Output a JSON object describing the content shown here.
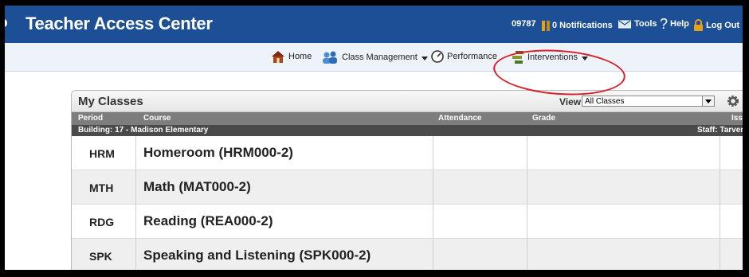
{
  "header": {
    "title": "Teacher Access Center",
    "staff_id": "09787",
    "notifications": "0 Notifications",
    "tools": "Tools",
    "help": "Help",
    "logout": "Log Out"
  },
  "nav": {
    "home": "Home",
    "class_management": "Class Management",
    "performance": "Performance",
    "interventions": "Interventions"
  },
  "panel": {
    "title": "My Classes",
    "view_label": "View",
    "view_value": "All Classes",
    "columns": [
      "Period",
      "Course",
      "Attendance",
      "Grade",
      "Issu"
    ],
    "building": "Building: 17 - Madison Elementary",
    "staff": "Staff: Tarver",
    "rows": [
      {
        "period": "HRM",
        "course": "Homeroom (HRM000-2)"
      },
      {
        "period": "MTH",
        "course": "Math (MAT000-2)"
      },
      {
        "period": "RDG",
        "course": "Reading (REA000-2)"
      },
      {
        "period": "SPK",
        "course": "Speaking and Listening (SPK000-2)"
      }
    ]
  },
  "colors": {
    "header_blue": "#1c4f96",
    "highlight_red": "#d81f2a",
    "gold_icon": "#e3a21a"
  }
}
